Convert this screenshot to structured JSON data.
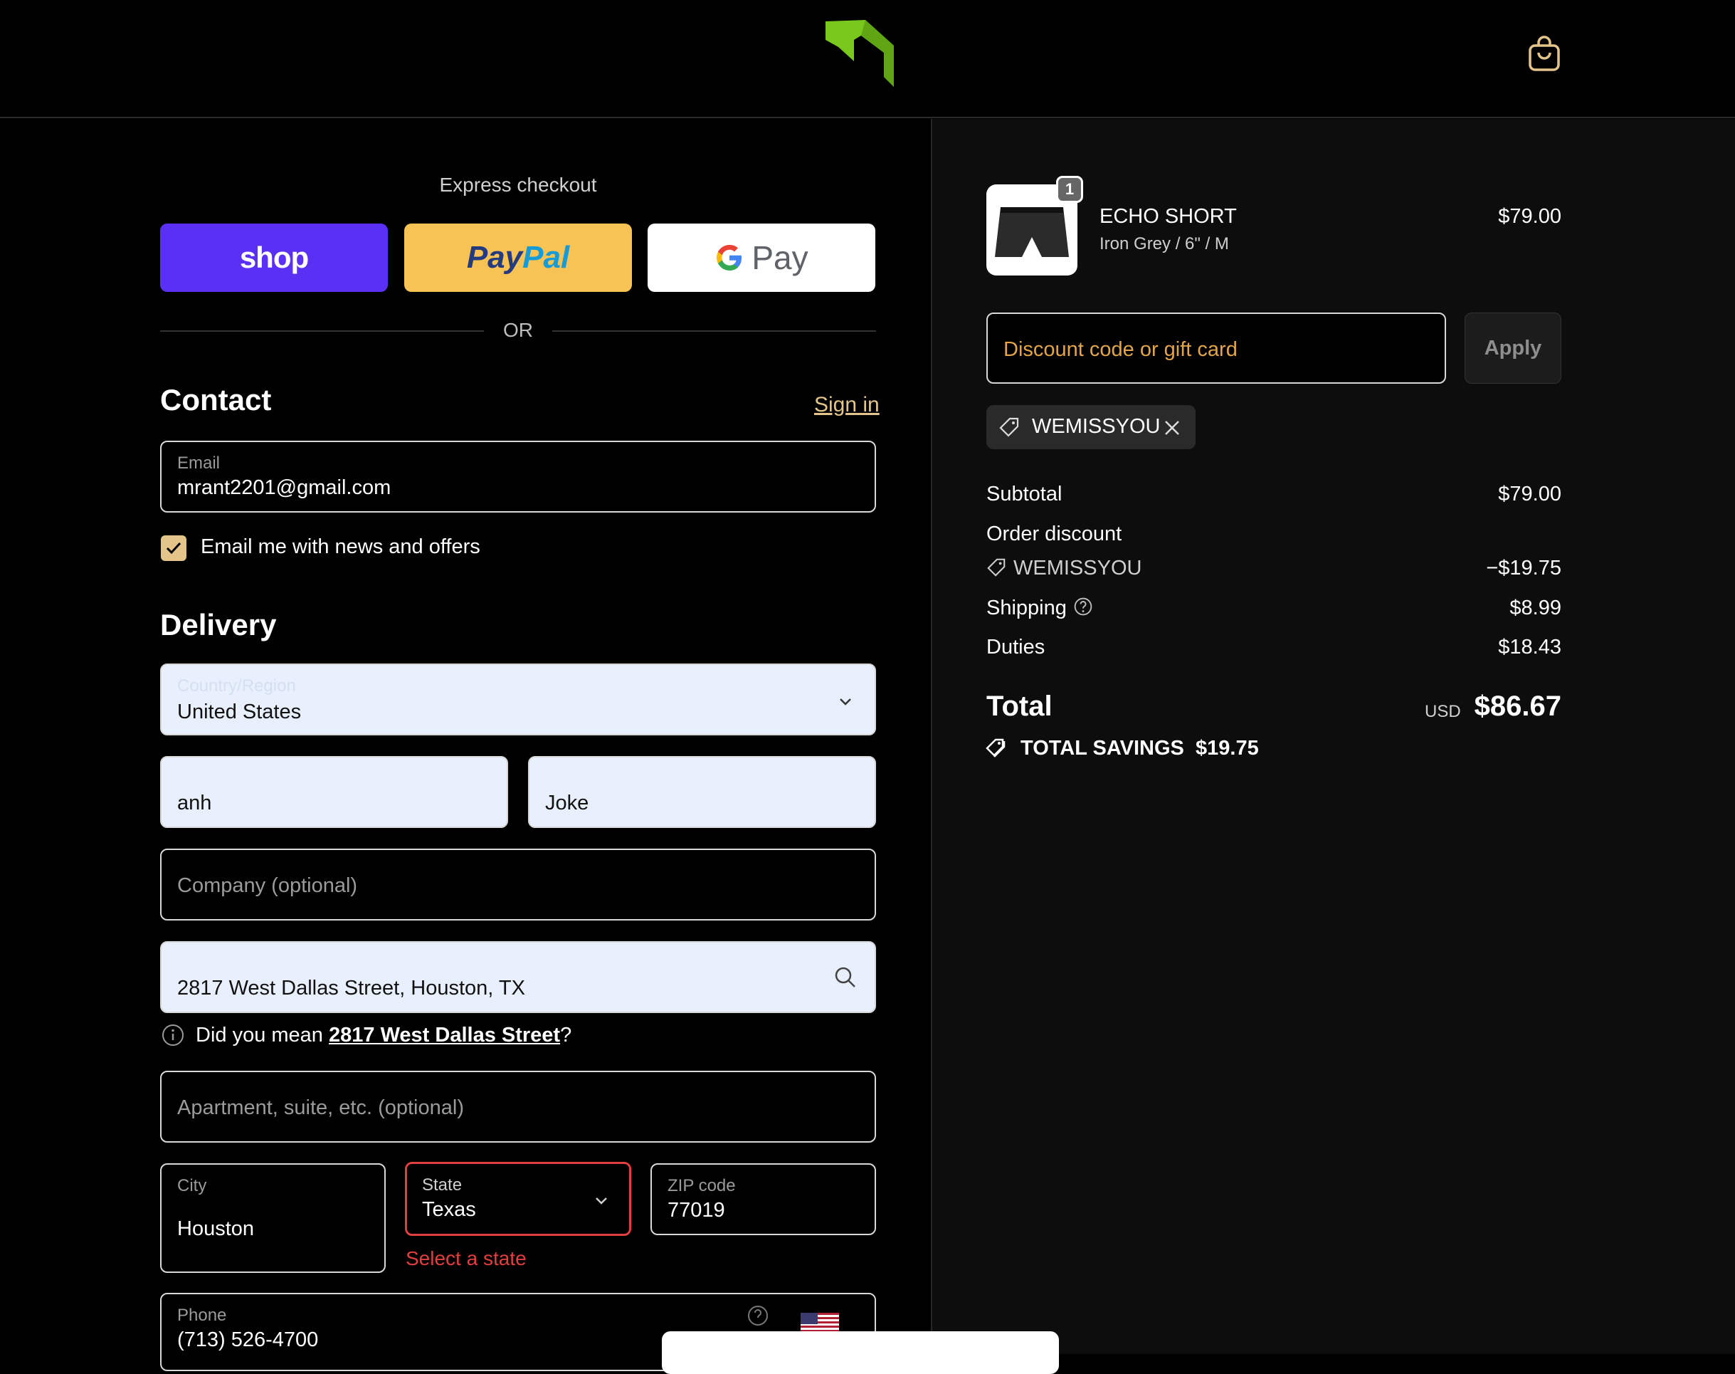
{
  "header": {
    "logo_icon": "brand-logo-icon",
    "cart_icon": "shopping-bag-icon"
  },
  "express": {
    "title": "Express checkout",
    "shop_label": "shop",
    "paypal_label_a": "Pay",
    "paypal_label_b": "Pal",
    "gpay_label": "Pay",
    "or_label": "OR"
  },
  "contact": {
    "title": "Contact",
    "sign_in": "Sign in",
    "email_label": "Email",
    "email_value": "mrant2201@gmail.com",
    "newsletter_label": "Email me with news and offers"
  },
  "delivery": {
    "title": "Delivery",
    "country_label": "Country/Region",
    "country_value": "United States",
    "first_name": "anh",
    "last_name": "Joke",
    "company_placeholder": "Company (optional)",
    "address_value": "2817 West Dallas Street, Houston, TX",
    "suggest_prefix": "Did you mean ",
    "suggest_link": "2817 West Dallas Street",
    "suggest_suffix": "?",
    "apartment_placeholder": "Apartment, suite, etc. (optional)",
    "city_label": "City",
    "city_value": "Houston",
    "state_label": "State",
    "state_value": "Texas",
    "state_error": "Select a state",
    "zip_label": "ZIP code",
    "zip_value": "77019",
    "phone_label": "Phone",
    "phone_value": "(713) 526-4700"
  },
  "order": {
    "qty_badge": "1",
    "product_name": "ECHO SHORT",
    "product_variant": "Iron Grey / 6\" / M",
    "product_price": "$79.00",
    "discount_placeholder": "Discount code or gift card",
    "apply_label": "Apply",
    "applied_code": "WEMISSYOU",
    "subtotal_label": "Subtotal",
    "subtotal_value": "$79.00",
    "order_discount_label": "Order discount",
    "discount_code": "WEMISSYOU",
    "discount_value": "−$19.75",
    "shipping_label": "Shipping",
    "shipping_value": "$8.99",
    "duties_label": "Duties",
    "duties_value": "$18.43",
    "total_label": "Total",
    "currency": "USD",
    "total_value": "$86.67",
    "savings_label": "TOTAL SAVINGS",
    "savings_value": "$19.75"
  },
  "colors": {
    "accent": "#e3c58a",
    "error": "#e03f3f",
    "shop": "#5a31f4",
    "paypal": "#f8c355",
    "autofill": "#e8f0fe"
  }
}
